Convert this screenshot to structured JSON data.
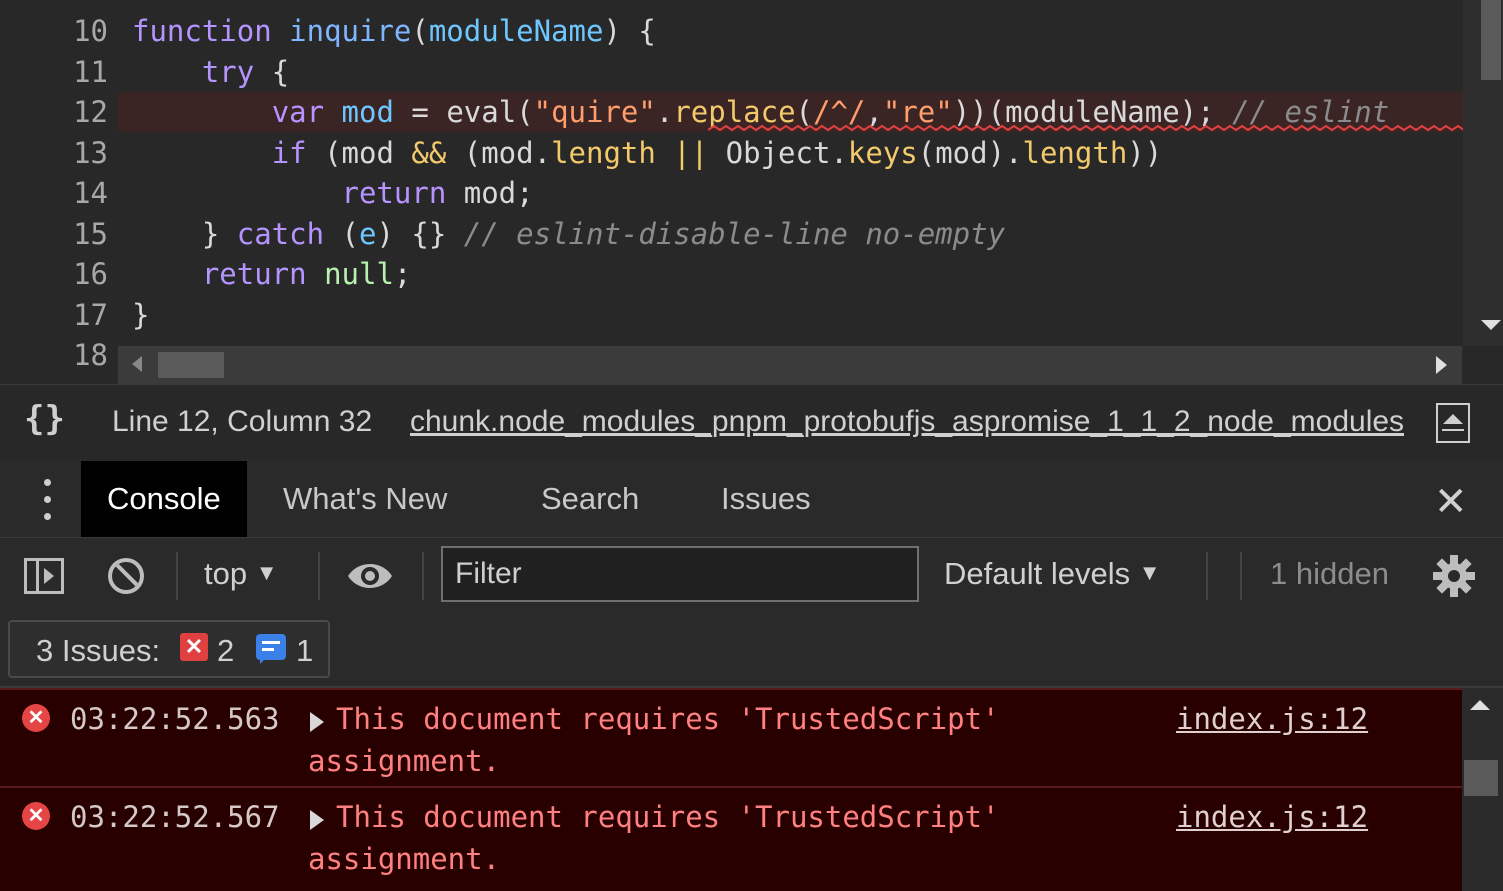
{
  "editor": {
    "line_numbers": [
      "10",
      "11",
      "12",
      "13",
      "14",
      "15",
      "16",
      "17",
      "18"
    ],
    "lines": [
      [
        {
          "c": "kw",
          "t": "function"
        },
        {
          "c": "",
          "t": " "
        },
        {
          "c": "fn",
          "t": "inquire"
        },
        {
          "c": "",
          "t": "("
        },
        {
          "c": "param",
          "t": "moduleName"
        },
        {
          "c": "",
          "t": ") {"
        }
      ],
      [
        {
          "c": "",
          "t": "    "
        },
        {
          "c": "kw",
          "t": "try"
        },
        {
          "c": "",
          "t": " {"
        }
      ],
      [
        {
          "c": "",
          "t": "        "
        },
        {
          "c": "kw",
          "t": "var"
        },
        {
          "c": "",
          "t": " "
        },
        {
          "c": "param",
          "t": "mod"
        },
        {
          "c": "",
          "t": " = eval("
        },
        {
          "c": "str",
          "t": "\"quire\""
        },
        {
          "c": "",
          "t": "."
        },
        {
          "c": "method",
          "t": "replace"
        },
        {
          "c": "",
          "t": "("
        },
        {
          "c": "str",
          "t": "/^/"
        },
        {
          "c": "",
          "t": ","
        },
        {
          "c": "str",
          "t": "\"re\""
        },
        {
          "c": "",
          "t": "))(moduleName); "
        },
        {
          "c": "comment",
          "t": "// eslint"
        }
      ],
      [
        {
          "c": "",
          "t": "        "
        },
        {
          "c": "kw",
          "t": "if"
        },
        {
          "c": "",
          "t": " (mod "
        },
        {
          "c": "method",
          "t": "&&"
        },
        {
          "c": "",
          "t": " (mod."
        },
        {
          "c": "method",
          "t": "length"
        },
        {
          "c": "",
          "t": " "
        },
        {
          "c": "method",
          "t": "||"
        },
        {
          "c": "",
          "t": " Object."
        },
        {
          "c": "method",
          "t": "keys"
        },
        {
          "c": "",
          "t": "(mod)."
        },
        {
          "c": "method",
          "t": "length"
        },
        {
          "c": "",
          "t": "))"
        }
      ],
      [
        {
          "c": "",
          "t": "            "
        },
        {
          "c": "kw",
          "t": "return"
        },
        {
          "c": "",
          "t": " mod;"
        }
      ],
      [
        {
          "c": "",
          "t": "    } "
        },
        {
          "c": "kw",
          "t": "catch"
        },
        {
          "c": "",
          "t": " ("
        },
        {
          "c": "param",
          "t": "e"
        },
        {
          "c": "",
          "t": ") {} "
        },
        {
          "c": "comment",
          "t": "// eslint-disable-line no-empty"
        }
      ],
      [
        {
          "c": "",
          "t": "    "
        },
        {
          "c": "kw",
          "t": "return"
        },
        {
          "c": "",
          "t": " "
        },
        {
          "c": "null",
          "t": "null"
        },
        {
          "c": "",
          "t": ";"
        }
      ],
      [
        {
          "c": "",
          "t": "}"
        }
      ],
      [
        {
          "c": "",
          "t": ""
        }
      ]
    ]
  },
  "status": {
    "braces": "{}",
    "position": "Line 12, Column 32",
    "file": "chunk.node_modules_pnpm_protobufjs_aspromise_1_1_2_node_modules"
  },
  "tabs": [
    "Console",
    "What's New",
    "Search",
    "Issues"
  ],
  "toolbar": {
    "context": "top",
    "filter_placeholder": "Filter",
    "levels": "Default levels",
    "hidden": "1 hidden"
  },
  "issues": {
    "label": "3 Issues:",
    "error_count": "2",
    "info_count": "1"
  },
  "messages": [
    {
      "time": "03:22:52.563",
      "text1": "This document requires 'TrustedScript'",
      "text2": "assignment.",
      "source": "index.js:12"
    },
    {
      "time": "03:22:52.567",
      "text1": "This document requires 'TrustedScript'",
      "text2": "assignment.",
      "source": "index.js:12"
    }
  ],
  "colors": {
    "error_red": "#e64545",
    "info_blue": "#3a80e8",
    "console_error_bg": "#290000"
  }
}
